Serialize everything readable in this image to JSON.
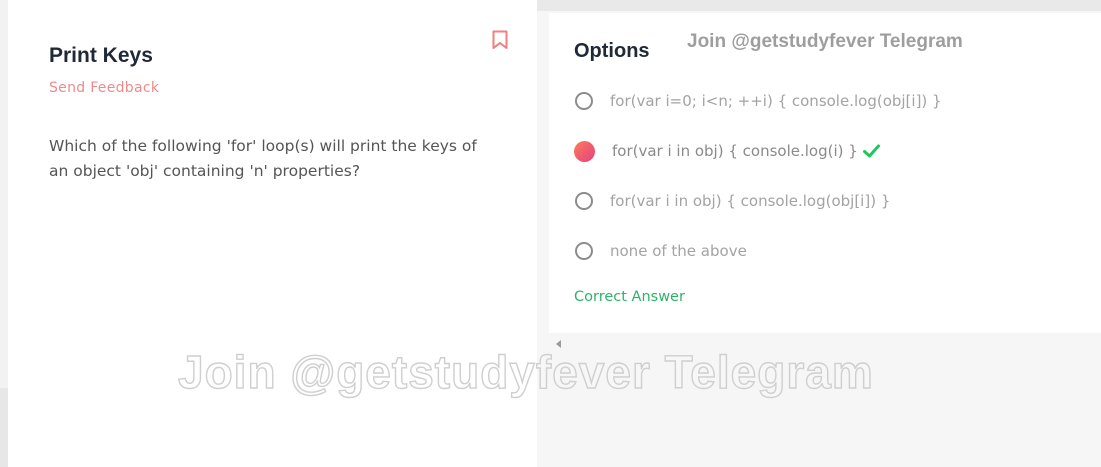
{
  "question": {
    "title": "Print Keys",
    "feedback_link": "Send Feedback",
    "text": "Which of the following 'for' loop(s) will print the keys of an object 'obj' containing 'n' properties?",
    "bookmark_icon": "bookmark-icon"
  },
  "options_panel": {
    "heading": "Options",
    "watermark": "Join @getstudyfever Telegram",
    "options": [
      {
        "label": "for(var i=0; i<n; ++i) { console.log(obj[i]) }",
        "selected": false
      },
      {
        "label": "for(var i in obj) { console.log(i) }",
        "selected": true,
        "correct": true
      },
      {
        "label": "for(var i in obj) { console.log(obj[i]) }",
        "selected": false
      },
      {
        "label": "none of the above",
        "selected": false
      }
    ],
    "correct_answer_label": "Correct Answer"
  },
  "overlay_watermark": "Join @getstudyfever Telegram",
  "colors": {
    "accent_coral": "#f08a8a",
    "correct_green": "#2fb36b",
    "selected_gradient_start": "#fb7f5a",
    "selected_gradient_end": "#e8417f"
  }
}
